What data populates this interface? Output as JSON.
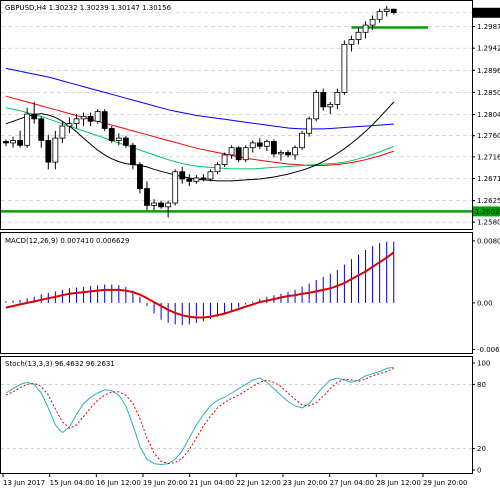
{
  "chart_data": [
    {
      "type": "candlestick",
      "title": "GBPUSD,H4  1.30232 1.30239 1.30147 1.30156",
      "ylim": [
        1.2568,
        1.3038
      ],
      "ytick_labels": [
        "1.30156",
        "1.29870",
        "1.29420",
        "1.28960",
        "1.28500",
        "1.28040",
        "1.27600",
        "1.27160",
        "1.26710",
        "1.26250",
        "1.26025",
        "1.25800"
      ],
      "ytick_values": [
        1.30156,
        1.2987,
        1.2942,
        1.2896,
        1.285,
        1.2804,
        1.276,
        1.2716,
        1.2671,
        1.2625,
        1.26025,
        1.258
      ],
      "grid": true,
      "support_level": 1.26025,
      "resistance_level": 1.2985,
      "candles": [
        [
          1.2748,
          1.2752,
          1.2738,
          1.2745
        ],
        [
          1.2745,
          1.2758,
          1.2735,
          1.275
        ],
        [
          1.275,
          1.277,
          1.2735,
          1.274
        ],
        [
          1.274,
          1.2818,
          1.2735,
          1.2805
        ],
        [
          1.2805,
          1.283,
          1.2785,
          1.2795
        ],
        [
          1.2795,
          1.28,
          1.2735,
          1.275
        ],
        [
          1.275,
          1.2762,
          1.269,
          1.2705
        ],
        [
          1.2705,
          1.277,
          1.269,
          1.2755
        ],
        [
          1.2755,
          1.279,
          1.2745,
          1.278
        ],
        [
          1.278,
          1.2798,
          1.2765,
          1.2785
        ],
        [
          1.2785,
          1.2805,
          1.2775,
          1.2795
        ],
        [
          1.2795,
          1.2808,
          1.278,
          1.28
        ],
        [
          1.28,
          1.2808,
          1.278,
          1.279
        ],
        [
          1.279,
          1.2815,
          1.2785,
          1.281
        ],
        [
          1.281,
          1.2815,
          1.277,
          1.2775
        ],
        [
          1.2775,
          1.278,
          1.2745,
          1.275
        ],
        [
          1.275,
          1.2765,
          1.274,
          1.2755
        ],
        [
          1.2755,
          1.276,
          1.2735,
          1.274
        ],
        [
          1.274,
          1.2745,
          1.269,
          1.27
        ],
        [
          1.27,
          1.2705,
          1.264,
          1.265
        ],
        [
          1.265,
          1.2665,
          1.2605,
          1.2615
        ],
        [
          1.2615,
          1.2628,
          1.2605,
          1.262
        ],
        [
          1.262,
          1.2625,
          1.2608,
          1.2612
        ],
        [
          1.2612,
          1.2625,
          1.259,
          1.262
        ],
        [
          1.262,
          1.269,
          1.2615,
          1.2685
        ],
        [
          1.2685,
          1.2695,
          1.266,
          1.267
        ],
        [
          1.267,
          1.268,
          1.2655,
          1.2665
        ],
        [
          1.2665,
          1.2678,
          1.266,
          1.2672
        ],
        [
          1.2672,
          1.268,
          1.2665,
          1.267
        ],
        [
          1.267,
          1.269,
          1.2665,
          1.2685
        ],
        [
          1.2685,
          1.2705,
          1.268,
          1.27
        ],
        [
          1.27,
          1.2725,
          1.2695,
          1.272
        ],
        [
          1.272,
          1.274,
          1.2712,
          1.2735
        ],
        [
          1.2735,
          1.2738,
          1.2705,
          1.271
        ],
        [
          1.271,
          1.274,
          1.2705,
          1.2735
        ],
        [
          1.2735,
          1.275,
          1.2725,
          1.2745
        ],
        [
          1.2745,
          1.2755,
          1.2732,
          1.2738
        ],
        [
          1.2738,
          1.2752,
          1.2728,
          1.2748
        ],
        [
          1.2748,
          1.2752,
          1.2715,
          1.2722
        ],
        [
          1.2722,
          1.273,
          1.2708,
          1.2725
        ],
        [
          1.2725,
          1.273,
          1.2715,
          1.272
        ],
        [
          1.272,
          1.274,
          1.271,
          1.2735
        ],
        [
          1.2735,
          1.277,
          1.273,
          1.2765
        ],
        [
          1.2765,
          1.28,
          1.2758,
          1.2795
        ],
        [
          1.2795,
          1.2855,
          1.279,
          1.285
        ],
        [
          1.285,
          1.2858,
          1.2812,
          1.282
        ],
        [
          1.282,
          1.283,
          1.2805,
          1.2825
        ],
        [
          1.2825,
          1.2858,
          1.2815,
          1.285
        ],
        [
          1.285,
          1.2958,
          1.2845,
          1.295
        ],
        [
          1.295,
          1.2968,
          1.2935,
          1.296
        ],
        [
          1.296,
          1.2985,
          1.295,
          1.2975
        ],
        [
          1.2975,
          1.2998,
          1.2962,
          1.299
        ],
        [
          1.299,
          1.301,
          1.298,
          1.3002
        ],
        [
          1.3002,
          1.3024,
          1.2995,
          1.3018
        ],
        [
          1.3018,
          1.303,
          1.3008,
          1.3023
        ],
        [
          1.3023,
          1.3024,
          1.3012,
          1.3016
        ]
      ],
      "moving_averages": [
        {
          "color": "#0000ff",
          "values": [
            1.29,
            1.2897,
            1.2894,
            1.2891,
            1.2888,
            1.2885,
            1.2882,
            1.2878,
            1.2874,
            1.287,
            1.2866,
            1.2862,
            1.2858,
            1.2854,
            1.285,
            1.2846,
            1.2842,
            1.2838,
            1.2834,
            1.283,
            1.2826,
            1.2822,
            1.2818,
            1.2814,
            1.2811,
            1.2808,
            1.2805,
            1.2802,
            1.28,
            1.2798,
            1.2796,
            1.2794,
            1.2792,
            1.279,
            1.2788,
            1.2786,
            1.2784,
            1.2782,
            1.278,
            1.2778,
            1.2776,
            1.2775,
            1.2774,
            1.2774,
            1.2774,
            1.2774,
            1.2775,
            1.2776,
            1.2777,
            1.2778,
            1.2779,
            1.278,
            1.2781,
            1.2782,
            1.2783,
            1.2784
          ]
        },
        {
          "color": "#ff0000",
          "values": [
            1.2842,
            1.2838,
            1.2834,
            1.283,
            1.2826,
            1.2822,
            1.2818,
            1.2814,
            1.281,
            1.2806,
            1.2802,
            1.2798,
            1.2794,
            1.279,
            1.2786,
            1.2782,
            1.2778,
            1.2774,
            1.277,
            1.2766,
            1.2762,
            1.2758,
            1.2754,
            1.275,
            1.2746,
            1.2742,
            1.2738,
            1.2734,
            1.2731,
            1.2728,
            1.2725,
            1.2722,
            1.2719,
            1.2716,
            1.2713,
            1.2711,
            1.2709,
            1.2707,
            1.2705,
            1.2703,
            1.2701,
            1.27,
            1.2699,
            1.2698,
            1.2698,
            1.2698,
            1.2699,
            1.27,
            1.2702,
            1.2704,
            1.2707,
            1.271,
            1.2714,
            1.2718,
            1.2723,
            1.2728
          ]
        },
        {
          "color": "#00c864",
          "values": [
            1.2818,
            1.2815,
            1.2812,
            1.2808,
            1.2804,
            1.28,
            1.2795,
            1.279,
            1.2785,
            1.278,
            1.2775,
            1.277,
            1.2765,
            1.276,
            1.2755,
            1.275,
            1.2745,
            1.274,
            1.2735,
            1.273,
            1.2725,
            1.272,
            1.2715,
            1.271,
            1.2706,
            1.2702,
            1.2699,
            1.2697,
            1.2695,
            1.2694,
            1.2693,
            1.2692,
            1.2691,
            1.2691,
            1.2691,
            1.2691,
            1.2692,
            1.2693,
            1.2694,
            1.2695,
            1.2696,
            1.2697,
            1.2698,
            1.2699,
            1.27,
            1.2701,
            1.2702,
            1.2703,
            1.2705,
            1.2708,
            1.2712,
            1.2716,
            1.2721,
            1.2726,
            1.2732,
            1.2738
          ]
        },
        {
          "color": "#000000",
          "values": [
            1.2785,
            1.279,
            1.2795,
            1.28,
            1.2804,
            1.2806,
            1.2803,
            1.2798,
            1.279,
            1.278,
            1.2768,
            1.2755,
            1.2742,
            1.273,
            1.272,
            1.2712,
            1.2706,
            1.2702,
            1.27,
            1.2698,
            1.2695,
            1.269,
            1.2686,
            1.2682,
            1.2678,
            1.2675,
            1.2672,
            1.267,
            1.2668,
            1.2667,
            1.2666,
            1.2666,
            1.2666,
            1.2667,
            1.2668,
            1.2669,
            1.267,
            1.2672,
            1.2674,
            1.2677,
            1.268,
            1.2684,
            1.2688,
            1.2693,
            1.2699,
            1.2706,
            1.2714,
            1.2723,
            1.2733,
            1.2744,
            1.2756,
            1.2769,
            1.2783,
            1.2798,
            1.2814,
            1.283
          ]
        }
      ]
    },
    {
      "type": "bar+line",
      "title": "MACD(12,26,9) 0.007410 0.006629",
      "ylim": [
        -0.0064,
        0.0082
      ],
      "ytick_labels": [
        "0.008077",
        "0.00",
        "-0.006061"
      ],
      "ytick_values": [
        0.008077,
        0.0,
        -0.006061
      ],
      "histogram": [
        0.0002,
        0.0003,
        0.0004,
        0.0006,
        0.0008,
        0.0011,
        0.0013,
        0.0015,
        0.0017,
        0.0019,
        0.002,
        0.0021,
        0.0022,
        0.0023,
        0.0024,
        0.0024,
        0.0023,
        0.0021,
        0.0016,
        0.0008,
        -0.0004,
        -0.0014,
        -0.0022,
        -0.0026,
        -0.0028,
        -0.0029,
        -0.0028,
        -0.0026,
        -0.0024,
        -0.0021,
        -0.0018,
        -0.0014,
        -0.001,
        -0.0006,
        -0.0002,
        0.0002,
        0.0005,
        0.0008,
        0.001,
        0.0012,
        0.0014,
        0.0017,
        0.0021,
        0.0025,
        0.003,
        0.0034,
        0.0038,
        0.0043,
        0.005,
        0.0057,
        0.0063,
        0.0069,
        0.0074,
        0.0078,
        0.008,
        0.008
      ],
      "signal": [
        -0.0006,
        -0.0004,
        -0.0002,
        0.0,
        0.0002,
        0.0004,
        0.0006,
        0.0008,
        0.001,
        0.0012,
        0.0013,
        0.0014,
        0.0015,
        0.0016,
        0.0017,
        0.0017,
        0.0017,
        0.0016,
        0.0014,
        0.0011,
        0.0006,
        0.0001,
        -0.0004,
        -0.0009,
        -0.0013,
        -0.0016,
        -0.0018,
        -0.0019,
        -0.0019,
        -0.0018,
        -0.0016,
        -0.0014,
        -0.0011,
        -0.0008,
        -0.0005,
        -0.0002,
        0.0001,
        0.0003,
        0.0005,
        0.0007,
        0.0009,
        0.001,
        0.0012,
        0.0013,
        0.0015,
        0.0017,
        0.0019,
        0.0022,
        0.0026,
        0.0031,
        0.0036,
        0.0041,
        0.0047,
        0.0053,
        0.0059,
        0.0066
      ],
      "colors": {
        "histogram": "#0000cc",
        "signal": "#dd0000"
      }
    },
    {
      "type": "line",
      "title": "Stoch(13,3,3) 96.4632 96.2631",
      "ylim": [
        0,
        100
      ],
      "ytick_labels": [
        "100",
        "80",
        "20",
        "0"
      ],
      "ytick_values": [
        100,
        80,
        20,
        0
      ],
      "main": [
        72,
        76,
        80,
        82,
        80,
        72,
        58,
        42,
        35,
        40,
        52,
        62,
        68,
        72,
        75,
        74,
        70,
        60,
        42,
        22,
        10,
        6,
        5,
        6,
        10,
        18,
        30,
        42,
        52,
        60,
        65,
        68,
        72,
        76,
        80,
        84,
        86,
        82,
        76,
        70,
        64,
        60,
        58,
        62,
        70,
        78,
        84,
        86,
        84,
        82,
        84,
        88,
        90,
        92,
        95,
        96
      ],
      "signal": [
        70,
        73,
        77,
        80,
        81,
        78,
        70,
        57,
        45,
        39,
        42,
        50,
        58,
        65,
        70,
        73,
        73,
        70,
        62,
        48,
        30,
        16,
        8,
        6,
        7,
        11,
        19,
        30,
        41,
        50,
        58,
        63,
        67,
        70,
        74,
        78,
        82,
        84,
        82,
        78,
        72,
        66,
        61,
        60,
        63,
        69,
        76,
        82,
        85,
        84,
        83,
        85,
        88,
        90,
        92,
        95
      ],
      "colors": {
        "main": "#2ab0c8",
        "signal": "#dd0000"
      }
    }
  ],
  "x_labels": [
    "13 Jun 2017",
    "15 Jun 04:00",
    "16 Jun 12:00",
    "19 Jun 20:00",
    "21 Jun 04:00",
    "22 Jun 12:00",
    "23 Jun 20:00",
    "27 Jun 04:00",
    "28 Jun 12:00",
    "29 Jun 20:00"
  ],
  "colors": {
    "bull_candle": "#ffffff",
    "bear_candle": "#000000",
    "level_line": "#00a000",
    "grid": "#c0c0c0",
    "price_tag": "#000000"
  }
}
